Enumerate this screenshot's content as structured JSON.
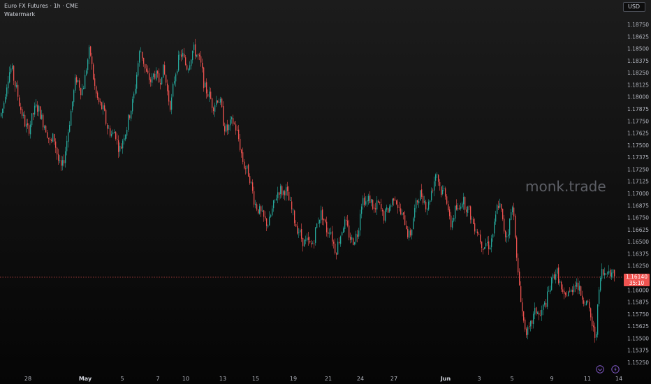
{
  "header": {
    "symbol_title": "Euro FX Futures · 1h · CME",
    "indicator_name": "Watermark"
  },
  "currency_button": "USD",
  "watermark_text": "monk.trade",
  "current_price": {
    "price": "1.16140",
    "countdown": "35:10"
  },
  "colors": {
    "up": "#26a69a",
    "down": "#ef5350",
    "axis_text": "#b2b5be",
    "price_line": "#f05350",
    "icon_accent": "#7e57c2"
  },
  "toolbar_icons": [
    "replay-icon",
    "lightning-icon"
  ],
  "chart_data": {
    "type": "candlestick",
    "interval": "1h",
    "y_axis": {
      "position": "right",
      "ticks": [
        "1.18750",
        "1.18625",
        "1.18500",
        "1.18375",
        "1.18250",
        "1.18125",
        "1.18000",
        "1.17875",
        "1.17750",
        "1.17625",
        "1.17500",
        "1.17375",
        "1.17250",
        "1.17125",
        "1.17000",
        "1.16875",
        "1.16750",
        "1.16625",
        "1.16500",
        "1.16375",
        "1.16250",
        "1.16000",
        "1.15875",
        "1.15750",
        "1.15625",
        "1.15500",
        "1.15375",
        "1.15250"
      ],
      "range": [
        1.1516,
        1.1888
      ]
    },
    "x_axis": {
      "ticks": [
        {
          "label": "28",
          "bold": false
        },
        {
          "label": "May",
          "bold": true
        },
        {
          "label": "5",
          "bold": false
        },
        {
          "label": "7",
          "bold": false
        },
        {
          "label": "10",
          "bold": false
        },
        {
          "label": "13",
          "bold": false
        },
        {
          "label": "15",
          "bold": false
        },
        {
          "label": "19",
          "bold": false
        },
        {
          "label": "21",
          "bold": false
        },
        {
          "label": "24",
          "bold": false
        },
        {
          "label": "27",
          "bold": false
        },
        {
          "label": "Jun",
          "bold": true
        },
        {
          "label": "3",
          "bold": false
        },
        {
          "label": "5",
          "bold": false
        },
        {
          "label": "9",
          "bold": false
        },
        {
          "label": "11",
          "bold": false
        },
        {
          "label": "14",
          "bold": false
        }
      ]
    },
    "close_path": [
      [
        0,
        1.178
      ],
      [
        4,
        1.179
      ],
      [
        8,
        1.181
      ],
      [
        12,
        1.1825
      ],
      [
        16,
        1.183
      ],
      [
        20,
        1.1815
      ],
      [
        24,
        1.1805
      ],
      [
        28,
        1.179
      ],
      [
        32,
        1.178
      ],
      [
        36,
        1.177
      ],
      [
        40,
        1.1765
      ],
      [
        44,
        1.1775
      ],
      [
        48,
        1.1785
      ],
      [
        52,
        1.179
      ],
      [
        56,
        1.1785
      ],
      [
        60,
        1.1775
      ],
      [
        64,
        1.177
      ],
      [
        68,
        1.176
      ],
      [
        72,
        1.175
      ],
      [
        76,
        1.176
      ],
      [
        80,
        1.1745
      ],
      [
        84,
        1.173
      ],
      [
        88,
        1.1725
      ],
      [
        92,
        1.174
      ],
      [
        96,
        1.176
      ],
      [
        100,
        1.178
      ],
      [
        104,
        1.18
      ],
      [
        108,
        1.182
      ],
      [
        112,
        1.1815
      ],
      [
        116,
        1.1805
      ],
      [
        120,
        1.1815
      ],
      [
        124,
        1.1835
      ],
      [
        128,
        1.185
      ],
      [
        132,
        1.1825
      ],
      [
        136,
        1.1805
      ],
      [
        140,
        1.1795
      ],
      [
        144,
        1.179
      ],
      [
        148,
        1.1785
      ],
      [
        152,
        1.177
      ],
      [
        156,
        1.1765
      ],
      [
        160,
        1.176
      ],
      [
        164,
        1.1765
      ],
      [
        168,
        1.175
      ],
      [
        172,
        1.1745
      ],
      [
        176,
        1.176
      ],
      [
        180,
        1.1765
      ],
      [
        184,
        1.178
      ],
      [
        188,
        1.179
      ],
      [
        192,
        1.1805
      ],
      [
        196,
        1.183
      ],
      [
        200,
        1.185
      ],
      [
        204,
        1.184
      ],
      [
        208,
        1.1825
      ],
      [
        212,
        1.182
      ],
      [
        216,
        1.1815
      ],
      [
        220,
        1.1825
      ],
      [
        224,
        1.182
      ],
      [
        228,
        1.1815
      ],
      [
        232,
        1.183
      ],
      [
        236,
        1.182
      ],
      [
        240,
        1.18
      ],
      [
        244,
        1.179
      ],
      [
        248,
        1.1815
      ],
      [
        252,
        1.183
      ],
      [
        256,
        1.184
      ],
      [
        260,
        1.1845
      ],
      [
        264,
        1.1835
      ],
      [
        268,
        1.183
      ],
      [
        272,
        1.184
      ],
      [
        276,
        1.185
      ],
      [
        280,
        1.1845
      ],
      [
        284,
        1.184
      ],
      [
        288,
        1.183
      ],
      [
        292,
        1.181
      ],
      [
        296,
        1.1805
      ],
      [
        300,
        1.18
      ],
      [
        304,
        1.179
      ],
      [
        308,
        1.1795
      ],
      [
        312,
        1.18
      ],
      [
        316,
        1.179
      ],
      [
        320,
        1.177
      ],
      [
        324,
        1.1765
      ],
      [
        328,
        1.177
      ],
      [
        332,
        1.1775
      ],
      [
        336,
        1.177
      ],
      [
        340,
        1.176
      ],
      [
        344,
        1.1745
      ],
      [
        348,
        1.173
      ],
      [
        352,
        1.1725
      ],
      [
        356,
        1.172
      ],
      [
        360,
        1.1705
      ],
      [
        364,
        1.169
      ],
      [
        368,
        1.1685
      ],
      [
        372,
        1.168
      ],
      [
        376,
        1.1675
      ],
      [
        380,
        1.167
      ],
      [
        384,
        1.1668
      ],
      [
        388,
        1.168
      ],
      [
        392,
        1.169
      ],
      [
        396,
        1.17
      ],
      [
        400,
        1.1705
      ],
      [
        404,
        1.17
      ],
      [
        408,
        1.1705
      ],
      [
        412,
        1.1695
      ],
      [
        416,
        1.1685
      ],
      [
        420,
        1.1675
      ],
      [
        424,
        1.1665
      ],
      [
        428,
        1.166
      ],
      [
        432,
        1.1652
      ],
      [
        436,
        1.1648
      ],
      [
        440,
        1.165
      ],
      [
        444,
        1.1645
      ],
      [
        448,
        1.165
      ],
      [
        452,
        1.1665
      ],
      [
        456,
        1.1675
      ],
      [
        460,
        1.168
      ],
      [
        464,
        1.167
      ],
      [
        468,
        1.166
      ],
      [
        472,
        1.1665
      ],
      [
        476,
        1.165
      ],
      [
        480,
        1.164
      ],
      [
        484,
        1.165
      ],
      [
        488,
        1.166
      ],
      [
        492,
        1.167
      ],
      [
        496,
        1.1665
      ],
      [
        500,
        1.1655
      ],
      [
        504,
        1.165
      ],
      [
        508,
        1.1655
      ],
      [
        512,
        1.166
      ],
      [
        516,
        1.169
      ],
      [
        520,
        1.1695
      ],
      [
        524,
        1.169
      ],
      [
        528,
        1.1695
      ],
      [
        532,
        1.169
      ],
      [
        536,
        1.168
      ],
      [
        540,
        1.169
      ],
      [
        544,
        1.1685
      ],
      [
        548,
        1.1675
      ],
      [
        552,
        1.168
      ],
      [
        556,
        1.1685
      ],
      [
        560,
        1.169
      ],
      [
        564,
        1.17
      ],
      [
        568,
        1.169
      ],
      [
        572,
        1.168
      ],
      [
        576,
        1.1675
      ],
      [
        580,
        1.167
      ],
      [
        584,
        1.1655
      ],
      [
        588,
        1.166
      ],
      [
        592,
        1.168
      ],
      [
        596,
        1.169
      ],
      [
        600,
        1.17
      ],
      [
        604,
        1.1698
      ],
      [
        608,
        1.169
      ],
      [
        612,
        1.1685
      ],
      [
        616,
        1.17
      ],
      [
        620,
        1.171
      ],
      [
        624,
        1.1725
      ],
      [
        628,
        1.171
      ],
      [
        632,
        1.17
      ],
      [
        636,
        1.1705
      ],
      [
        640,
        1.169
      ],
      [
        644,
        1.1665
      ],
      [
        648,
        1.1675
      ],
      [
        652,
        1.1685
      ],
      [
        656,
        1.168
      ],
      [
        660,
        1.1695
      ],
      [
        664,
        1.169
      ],
      [
        668,
        1.1685
      ],
      [
        672,
        1.168
      ],
      [
        676,
        1.167
      ],
      [
        680,
        1.1665
      ],
      [
        684,
        1.166
      ],
      [
        688,
        1.165
      ],
      [
        692,
        1.1645
      ],
      [
        696,
        1.165
      ],
      [
        700,
        1.1645
      ],
      [
        704,
        1.1655
      ],
      [
        708,
        1.167
      ],
      [
        712,
        1.169
      ],
      [
        716,
        1.1685
      ],
      [
        720,
        1.1665
      ],
      [
        724,
        1.1655
      ],
      [
        728,
        1.1665
      ],
      [
        732,
        1.1685
      ],
      [
        736,
        1.168
      ],
      [
        738,
        1.164
      ],
      [
        740,
        1.162
      ],
      [
        744,
        1.16
      ],
      [
        748,
        1.157
      ],
      [
        752,
        1.156
      ],
      [
        756,
        1.1555
      ],
      [
        760,
        1.1565
      ],
      [
        764,
        1.1575
      ],
      [
        768,
        1.158
      ],
      [
        772,
        1.157
      ],
      [
        776,
        1.158
      ],
      [
        780,
        1.1585
      ],
      [
        784,
        1.1595
      ],
      [
        788,
        1.1605
      ],
      [
        792,
        1.1615
      ],
      [
        796,
        1.162
      ],
      [
        800,
        1.161
      ],
      [
        804,
        1.1595
      ],
      [
        808,
        1.159
      ],
      [
        812,
        1.16
      ],
      [
        816,
        1.1595
      ],
      [
        820,
        1.1605
      ],
      [
        824,
        1.161
      ],
      [
        828,
        1.16
      ],
      [
        832,
        1.1595
      ],
      [
        836,
        1.159
      ],
      [
        840,
        1.1585
      ],
      [
        844,
        1.1575
      ],
      [
        848,
        1.156
      ],
      [
        852,
        1.155
      ],
      [
        856,
        1.159
      ],
      [
        860,
        1.162
      ],
      [
        864,
        1.1615
      ],
      [
        868,
        1.1625
      ],
      [
        872,
        1.1615
      ],
      [
        876,
        1.162
      ],
      [
        880,
        1.1614
      ]
    ]
  }
}
